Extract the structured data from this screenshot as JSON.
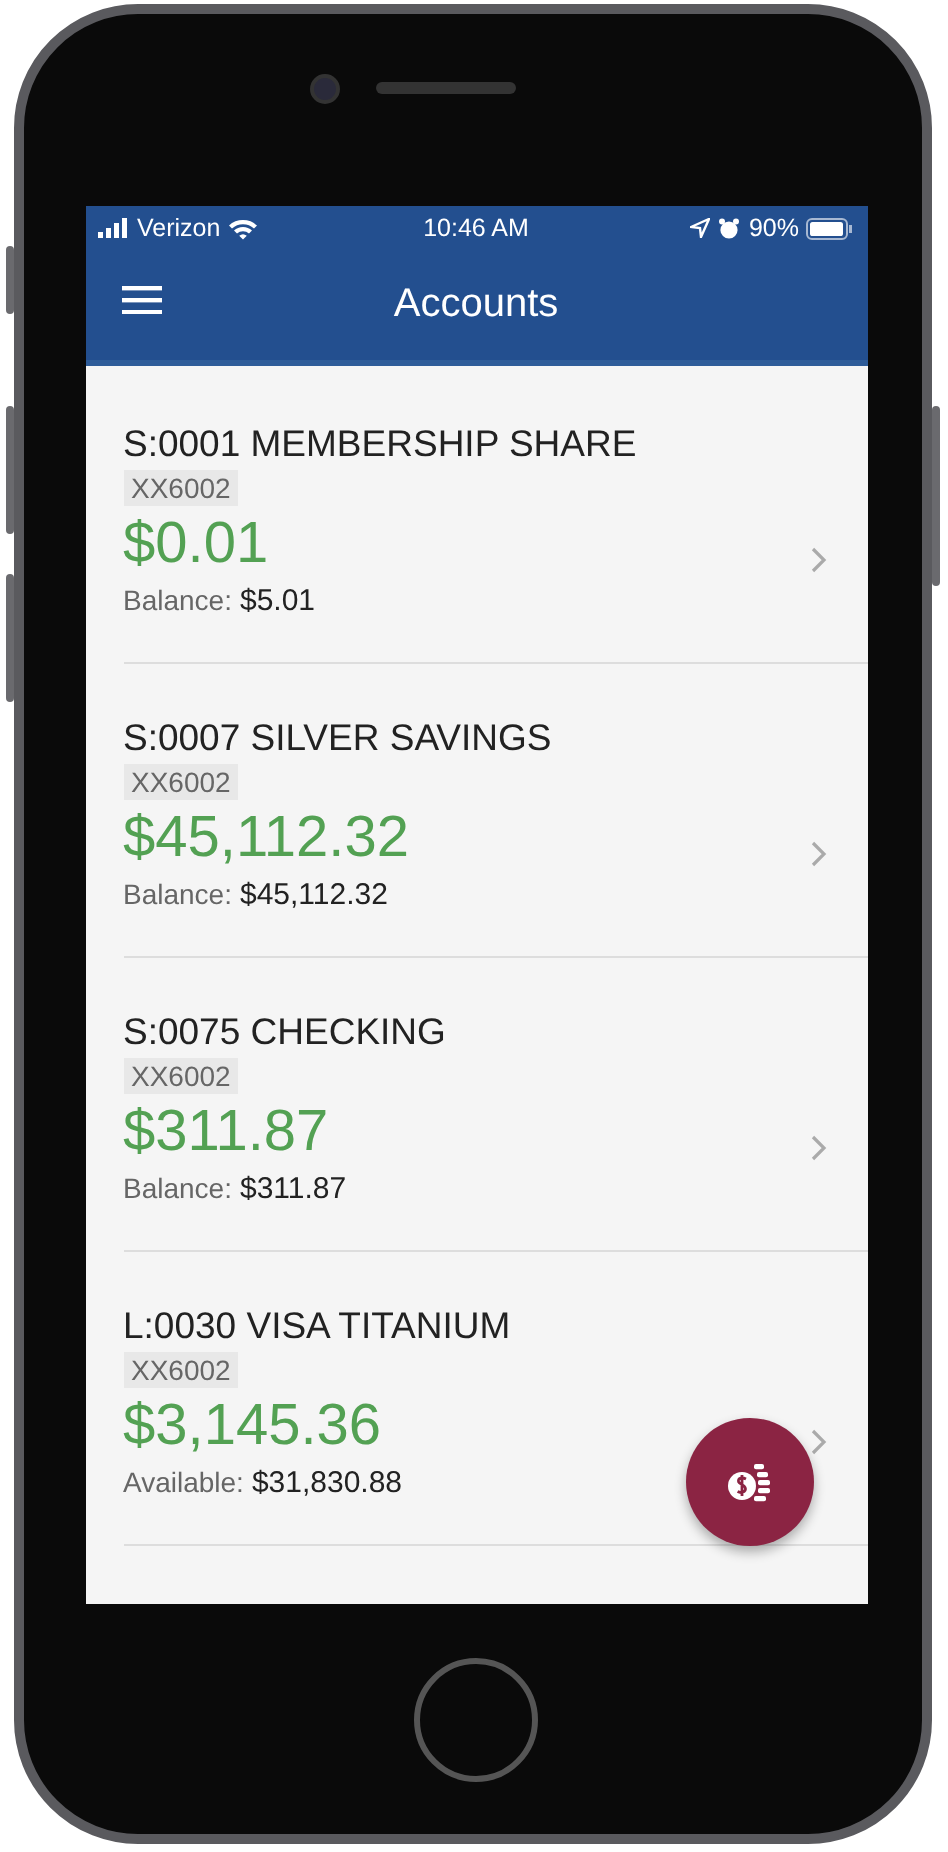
{
  "status_bar": {
    "carrier": "Verizon",
    "time": "10:46 AM",
    "battery": "90%"
  },
  "header": {
    "title": "Accounts"
  },
  "accounts": [
    {
      "name": "S:0001 MEMBERSHIP SHARE",
      "number": "XX6002",
      "amount": "$0.01",
      "balance_label": "Balance:",
      "balance": "$5.01"
    },
    {
      "name": "S:0007 SILVER SAVINGS",
      "number": "XX6002",
      "amount": "$45,112.32",
      "balance_label": "Balance:",
      "balance": "$45,112.32"
    },
    {
      "name": "S:0075 CHECKING",
      "number": "XX6002",
      "amount": "$311.87",
      "balance_label": "Balance:",
      "balance": "$311.87"
    },
    {
      "name": "L:0030 VISA TITANIUM",
      "number": "XX6002",
      "amount": "$3,145.36",
      "balance_label": "Available:",
      "balance": "$31,830.88"
    }
  ]
}
